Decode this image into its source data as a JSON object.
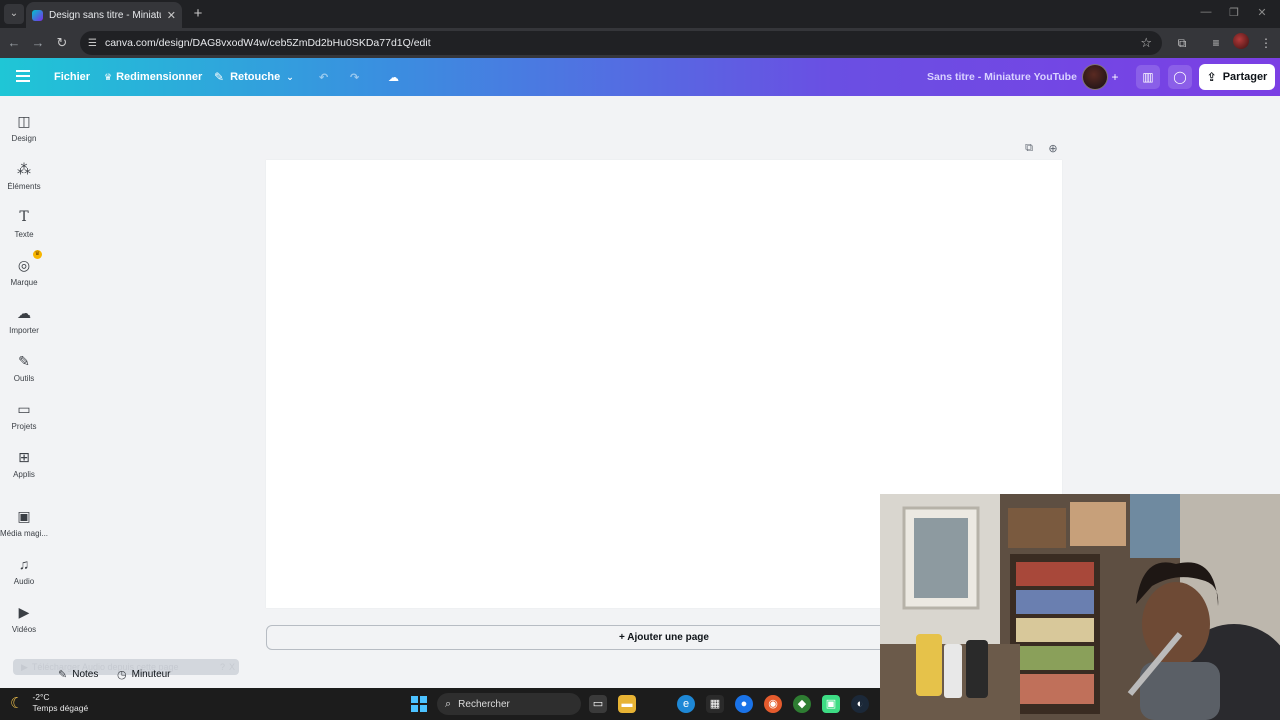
{
  "browser": {
    "tab_title": "Design sans titre - Miniature YouTube",
    "url": "canva.com/design/DAG8vxodW4w/ceb5ZmDd2bHu0SKDa77d1Q/edit"
  },
  "header": {
    "file_label": "Fichier",
    "resize_label": "Redimensionner",
    "retouch_label": "Retouche",
    "design_title": "Sans titre - Miniature YouTube",
    "share_label": "Partager"
  },
  "sidebar": {
    "items": [
      {
        "label": "Design",
        "icon": "layout-icon"
      },
      {
        "label": "Éléments",
        "icon": "shapes-icon"
      },
      {
        "label": "Texte",
        "icon": "text-icon"
      },
      {
        "label": "Marque",
        "icon": "brand-icon"
      },
      {
        "label": "Importer",
        "icon": "cloud-upload-icon"
      },
      {
        "label": "Outils",
        "icon": "pen-icon"
      },
      {
        "label": "Projets",
        "icon": "folder-icon"
      },
      {
        "label": "Applis",
        "icon": "apps-icon"
      },
      {
        "label": "Média magi...",
        "icon": "magic-media-icon"
      },
      {
        "label": "Audio",
        "icon": "music-icon"
      },
      {
        "label": "Vidéos",
        "icon": "video-icon"
      }
    ]
  },
  "canvas": {
    "add_page_label": "+ Ajouter une page"
  },
  "bottom": {
    "download_audio": "Télécharger Audio depuis cette page",
    "download_help": "?",
    "download_close": "X",
    "notes_label": "Notes",
    "timer_label": "Minuteur"
  },
  "taskbar": {
    "temperature": "-2°C",
    "weather": "Temps dégagé",
    "search_label": "Rechercher"
  },
  "colors": {
    "header_gradient_start": "#1fc6d6",
    "header_gradient_end": "#7b3fe4",
    "canvas_bg": "#ffffff",
    "workspace_bg": "#f2f3f5",
    "taskbar_bg": "#1c1c1c"
  }
}
